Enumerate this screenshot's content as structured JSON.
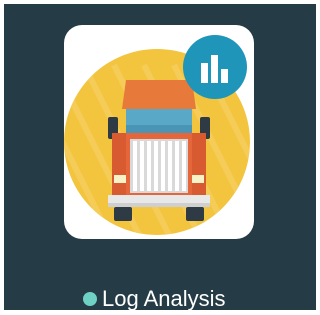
{
  "app": {
    "name": "Log Analysis",
    "icon": "truck-icon",
    "badge_icon": "bar-chart-icon",
    "status": "active"
  },
  "colors": {
    "background": "#253b45",
    "tile": "#ffffff",
    "circle": "#f3c43e",
    "truck_body": "#e4663a",
    "truck_roof": "#e77a3a",
    "windshield": "#5aa8c8",
    "grille": "#e6e6e6",
    "badge": "#1f95b9",
    "status_dot": "#6fd0c4",
    "label": "#ffffff"
  }
}
